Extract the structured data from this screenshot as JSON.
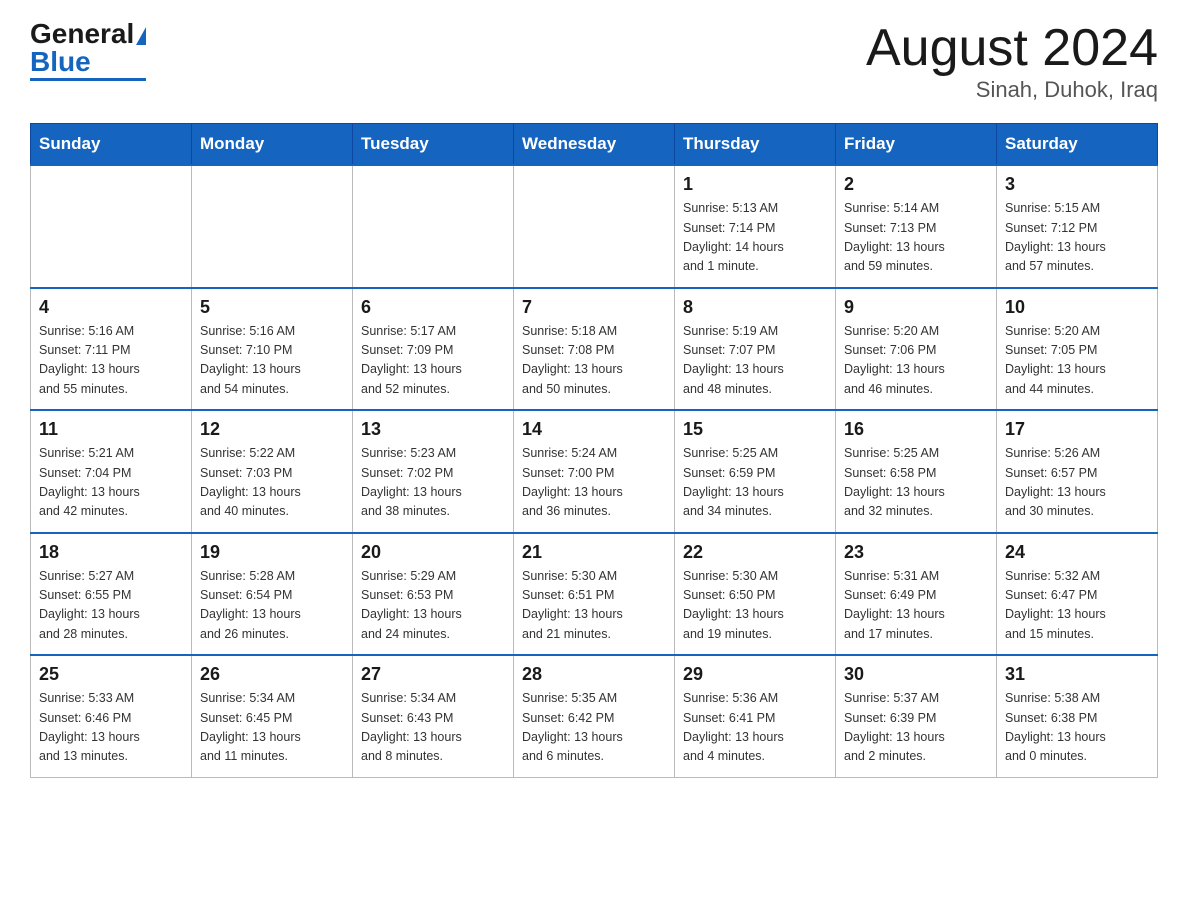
{
  "header": {
    "logo_general": "General",
    "logo_blue": "Blue",
    "month": "August 2024",
    "location": "Sinah, Duhok, Iraq"
  },
  "days_of_week": [
    "Sunday",
    "Monday",
    "Tuesday",
    "Wednesday",
    "Thursday",
    "Friday",
    "Saturday"
  ],
  "weeks": [
    [
      {
        "day": "",
        "info": ""
      },
      {
        "day": "",
        "info": ""
      },
      {
        "day": "",
        "info": ""
      },
      {
        "day": "",
        "info": ""
      },
      {
        "day": "1",
        "info": "Sunrise: 5:13 AM\nSunset: 7:14 PM\nDaylight: 14 hours\nand 1 minute."
      },
      {
        "day": "2",
        "info": "Sunrise: 5:14 AM\nSunset: 7:13 PM\nDaylight: 13 hours\nand 59 minutes."
      },
      {
        "day": "3",
        "info": "Sunrise: 5:15 AM\nSunset: 7:12 PM\nDaylight: 13 hours\nand 57 minutes."
      }
    ],
    [
      {
        "day": "4",
        "info": "Sunrise: 5:16 AM\nSunset: 7:11 PM\nDaylight: 13 hours\nand 55 minutes."
      },
      {
        "day": "5",
        "info": "Sunrise: 5:16 AM\nSunset: 7:10 PM\nDaylight: 13 hours\nand 54 minutes."
      },
      {
        "day": "6",
        "info": "Sunrise: 5:17 AM\nSunset: 7:09 PM\nDaylight: 13 hours\nand 52 minutes."
      },
      {
        "day": "7",
        "info": "Sunrise: 5:18 AM\nSunset: 7:08 PM\nDaylight: 13 hours\nand 50 minutes."
      },
      {
        "day": "8",
        "info": "Sunrise: 5:19 AM\nSunset: 7:07 PM\nDaylight: 13 hours\nand 48 minutes."
      },
      {
        "day": "9",
        "info": "Sunrise: 5:20 AM\nSunset: 7:06 PM\nDaylight: 13 hours\nand 46 minutes."
      },
      {
        "day": "10",
        "info": "Sunrise: 5:20 AM\nSunset: 7:05 PM\nDaylight: 13 hours\nand 44 minutes."
      }
    ],
    [
      {
        "day": "11",
        "info": "Sunrise: 5:21 AM\nSunset: 7:04 PM\nDaylight: 13 hours\nand 42 minutes."
      },
      {
        "day": "12",
        "info": "Sunrise: 5:22 AM\nSunset: 7:03 PM\nDaylight: 13 hours\nand 40 minutes."
      },
      {
        "day": "13",
        "info": "Sunrise: 5:23 AM\nSunset: 7:02 PM\nDaylight: 13 hours\nand 38 minutes."
      },
      {
        "day": "14",
        "info": "Sunrise: 5:24 AM\nSunset: 7:00 PM\nDaylight: 13 hours\nand 36 minutes."
      },
      {
        "day": "15",
        "info": "Sunrise: 5:25 AM\nSunset: 6:59 PM\nDaylight: 13 hours\nand 34 minutes."
      },
      {
        "day": "16",
        "info": "Sunrise: 5:25 AM\nSunset: 6:58 PM\nDaylight: 13 hours\nand 32 minutes."
      },
      {
        "day": "17",
        "info": "Sunrise: 5:26 AM\nSunset: 6:57 PM\nDaylight: 13 hours\nand 30 minutes."
      }
    ],
    [
      {
        "day": "18",
        "info": "Sunrise: 5:27 AM\nSunset: 6:55 PM\nDaylight: 13 hours\nand 28 minutes."
      },
      {
        "day": "19",
        "info": "Sunrise: 5:28 AM\nSunset: 6:54 PM\nDaylight: 13 hours\nand 26 minutes."
      },
      {
        "day": "20",
        "info": "Sunrise: 5:29 AM\nSunset: 6:53 PM\nDaylight: 13 hours\nand 24 minutes."
      },
      {
        "day": "21",
        "info": "Sunrise: 5:30 AM\nSunset: 6:51 PM\nDaylight: 13 hours\nand 21 minutes."
      },
      {
        "day": "22",
        "info": "Sunrise: 5:30 AM\nSunset: 6:50 PM\nDaylight: 13 hours\nand 19 minutes."
      },
      {
        "day": "23",
        "info": "Sunrise: 5:31 AM\nSunset: 6:49 PM\nDaylight: 13 hours\nand 17 minutes."
      },
      {
        "day": "24",
        "info": "Sunrise: 5:32 AM\nSunset: 6:47 PM\nDaylight: 13 hours\nand 15 minutes."
      }
    ],
    [
      {
        "day": "25",
        "info": "Sunrise: 5:33 AM\nSunset: 6:46 PM\nDaylight: 13 hours\nand 13 minutes."
      },
      {
        "day": "26",
        "info": "Sunrise: 5:34 AM\nSunset: 6:45 PM\nDaylight: 13 hours\nand 11 minutes."
      },
      {
        "day": "27",
        "info": "Sunrise: 5:34 AM\nSunset: 6:43 PM\nDaylight: 13 hours\nand 8 minutes."
      },
      {
        "day": "28",
        "info": "Sunrise: 5:35 AM\nSunset: 6:42 PM\nDaylight: 13 hours\nand 6 minutes."
      },
      {
        "day": "29",
        "info": "Sunrise: 5:36 AM\nSunset: 6:41 PM\nDaylight: 13 hours\nand 4 minutes."
      },
      {
        "day": "30",
        "info": "Sunrise: 5:37 AM\nSunset: 6:39 PM\nDaylight: 13 hours\nand 2 minutes."
      },
      {
        "day": "31",
        "info": "Sunrise: 5:38 AM\nSunset: 6:38 PM\nDaylight: 13 hours\nand 0 minutes."
      }
    ]
  ]
}
